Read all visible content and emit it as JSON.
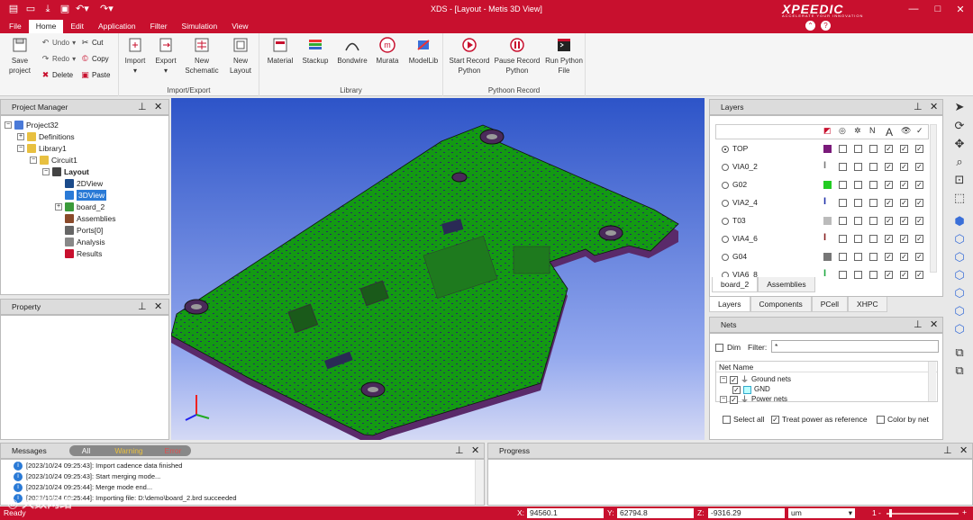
{
  "titlebar": {
    "title": "XDS - [Layout - Metis 3D View]",
    "brand": "XPEEDIC",
    "brand_sub": "ACCELERATE YOUR INNOVATION",
    "win_buttons": [
      "—",
      "□",
      "✕"
    ]
  },
  "menu": {
    "items": [
      "File",
      "Home",
      "Edit",
      "Application",
      "Filter",
      "Simulation",
      "View"
    ],
    "active": "Home"
  },
  "ribbon": {
    "save": "Save\nproject",
    "undo": "Undo",
    "redo": "Redo",
    "delete": "Delete",
    "cut": "Cut",
    "copy": "Copy",
    "paste": "Paste",
    "import": "Import",
    "export": "Export",
    "new_schematic": "New\nSchematic",
    "new_layout": "New\nLayout",
    "import_export_label": "Import/Export",
    "material": "Material",
    "stackup": "Stackup",
    "bondwire": "Bondwire",
    "murata": "Murata",
    "modellib": "ModelLib",
    "library_label": "Library",
    "start_record": "Start Record\nPython",
    "pause_record": "Pause Record\nPython",
    "run_python": "Run Python\nFile",
    "python_label": "Pythoon Record"
  },
  "project_manager": {
    "title": "Project Manager",
    "tree": [
      {
        "label": "Project32",
        "indent": 0,
        "expand": "-",
        "icon": "project-icon"
      },
      {
        "label": "Definitions",
        "indent": 1,
        "expand": "+",
        "icon": "folder-icon"
      },
      {
        "label": "Library1",
        "indent": 1,
        "expand": "-",
        "icon": "folder-icon"
      },
      {
        "label": "Circuit1",
        "indent": 2,
        "expand": "-",
        "icon": "folder-icon"
      },
      {
        "label": "Layout",
        "indent": 3,
        "expand": "-",
        "icon": "layout-icon",
        "bold": true
      },
      {
        "label": "2DView",
        "indent": 4,
        "icon": "view2d-icon"
      },
      {
        "label": "3DView",
        "indent": 4,
        "icon": "view3d-icon",
        "selected": true
      },
      {
        "label": "board_2",
        "indent": 4,
        "expand": "+",
        "icon": "board-icon"
      },
      {
        "label": "Assemblies",
        "indent": 4,
        "icon": "assembly-icon"
      },
      {
        "label": "Ports[0]",
        "indent": 4,
        "icon": "port-icon"
      },
      {
        "label": "Analysis",
        "indent": 4,
        "icon": "analysis-icon"
      },
      {
        "label": "Results",
        "indent": 4,
        "icon": "results-icon"
      }
    ]
  },
  "property": {
    "title": "Property"
  },
  "layers": {
    "title": "Layers",
    "header_icons": [
      "color-icon",
      "target-icon",
      "hatch-icon",
      "italic-n-icon",
      "text-a-icon",
      "eye-icon",
      "check-icon"
    ],
    "rows": [
      {
        "name": "TOP",
        "color": "#7a1a7a",
        "selected": true,
        "swatch": "square",
        "checks": [
          false,
          false,
          false,
          true,
          true,
          true
        ]
      },
      {
        "name": "VIA0_2",
        "color": "#7a7a7a",
        "swatch": "via",
        "checks": [
          false,
          false,
          false,
          true,
          true,
          true
        ]
      },
      {
        "name": "G02",
        "color": "#22cc22",
        "swatch": "square",
        "checks": [
          false,
          false,
          false,
          true,
          true,
          true
        ]
      },
      {
        "name": "VIA2_4",
        "color": "#2233aa",
        "swatch": "via",
        "checks": [
          false,
          false,
          false,
          true,
          true,
          true
        ]
      },
      {
        "name": "T03",
        "color": "#bbbbbb",
        "swatch": "square",
        "checks": [
          false,
          false,
          false,
          true,
          true,
          true
        ]
      },
      {
        "name": "VIA4_6",
        "color": "#882222",
        "swatch": "via",
        "checks": [
          false,
          false,
          false,
          true,
          true,
          true
        ]
      },
      {
        "name": "G04",
        "color": "#777777",
        "swatch": "square",
        "checks": [
          false,
          false,
          false,
          true,
          true,
          true
        ]
      },
      {
        "name": "VIA6_8",
        "color": "#22aa44",
        "swatch": "via",
        "checks": [
          false,
          false,
          false,
          true,
          true,
          true
        ]
      }
    ],
    "sub_tabs": [
      "board_2",
      "Assemblies"
    ],
    "tabs": [
      "Layers",
      "Components",
      "PCell",
      "XHPC"
    ]
  },
  "nets": {
    "title": "Nets",
    "dim": "Dim",
    "filter_label": "Filter:",
    "filter_value": "*",
    "col": "Net Name",
    "items": [
      {
        "label": "Ground nets",
        "indent": 0
      },
      {
        "label": "GND",
        "indent": 1
      },
      {
        "label": "Power nets",
        "indent": 0
      }
    ],
    "select_all": "Select all",
    "treat_power": "Treat power as reference",
    "color_by_net": "Color by net"
  },
  "messages": {
    "title": "Messages",
    "filters": [
      "All",
      "Warning",
      "Error"
    ],
    "rows": [
      "[2023/10/24 09:25:43]: Import cadence data finished",
      "[2023/10/24 09:25:43]: Start merging mode...",
      "[2023/10/24 09:25:44]: Merge mode end...",
      "[2023/10/24 09:25:44]: Importing file: D:\\demo\\board_2.brd succeeded"
    ]
  },
  "progress": {
    "title": "Progress"
  },
  "status": {
    "ready": "Ready",
    "x_label": "X:",
    "x": "94560.1",
    "y_label": "Y:",
    "y": "62794.8",
    "z_label": "Z:",
    "z": "-9316.29",
    "unit": "um",
    "zoom": "1"
  },
  "watermark": "大数网络"
}
